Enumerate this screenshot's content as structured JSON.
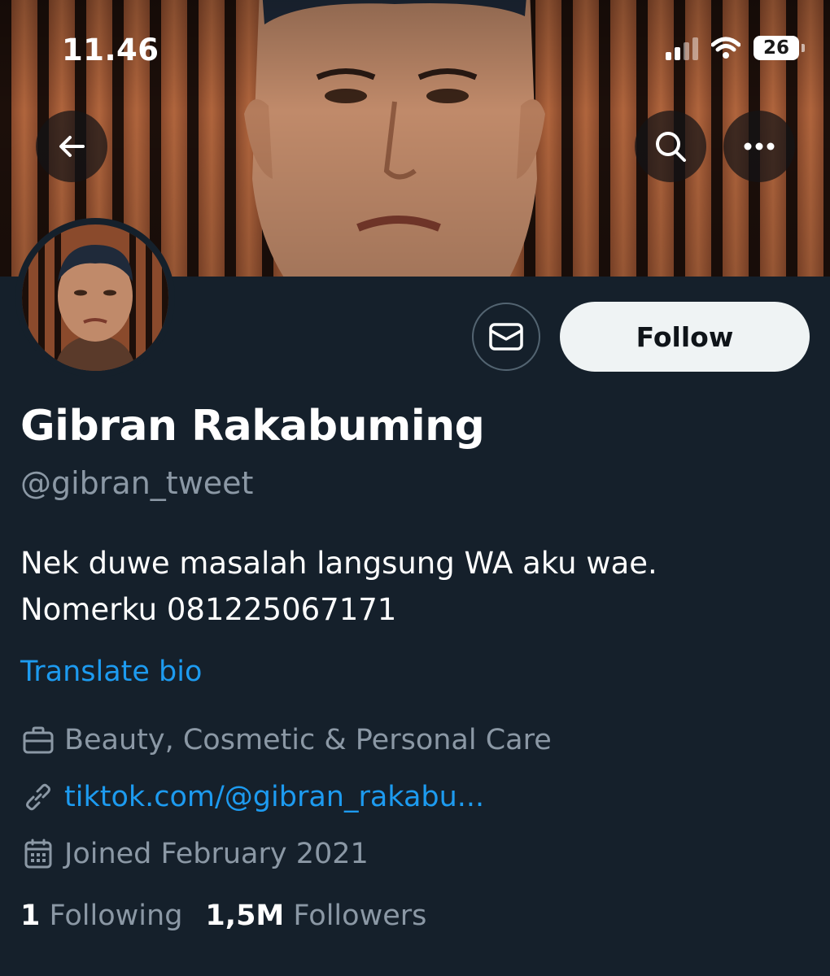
{
  "status_bar": {
    "time": "11.46",
    "battery": "26"
  },
  "nav": {
    "back_icon": "arrow-left-icon",
    "search_icon": "search-icon",
    "more_icon": "more-horizontal-icon"
  },
  "profile": {
    "name": "Gibran Rakabuming",
    "handle": "@gibran_tweet",
    "bio_line1": "Nek duwe masalah langsung WA aku wae.",
    "bio_line2": "Nomerku 081225067171",
    "translate_label": "Translate bio",
    "category": "Beauty, Cosmetic & Personal Care",
    "website": "tiktok.com/@gibran_rakabu...",
    "joined": "Joined February 2021",
    "following_count": "1",
    "following_label": "Following",
    "followers_count": "1,5M",
    "followers_label": "Followers"
  },
  "actions": {
    "follow_label": "Follow",
    "message_icon": "envelope-icon"
  },
  "colors": {
    "background": "#15202b",
    "accent": "#1d9bf0",
    "muted": "#8b98a5",
    "follow_bg": "#eff3f4"
  }
}
